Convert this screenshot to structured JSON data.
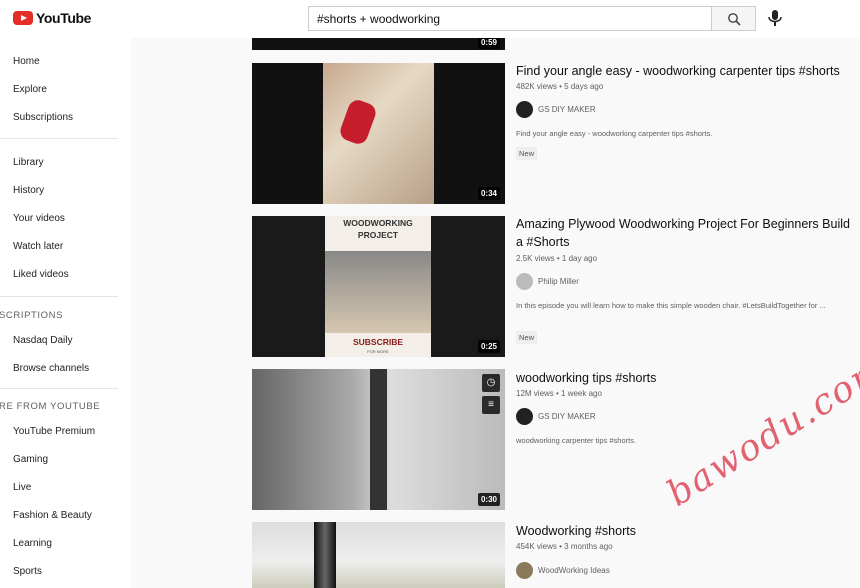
{
  "app": {
    "name": "YouTube"
  },
  "search": {
    "value": "#shorts + woodworking"
  },
  "sidebar": {
    "main": [
      "Home",
      "Explore",
      "Subscriptions"
    ],
    "library": [
      "Library",
      "History",
      "Your videos",
      "Watch later",
      "Liked videos"
    ],
    "subs_title": "SCRIPTIONS",
    "subs": [
      "Nasdaq Daily",
      "Browse channels"
    ],
    "more_title": "RE FROM YOUTUBE",
    "more": [
      "YouTube Premium",
      "Gaming",
      "Live",
      "Fashion & Beauty",
      "Learning",
      "Sports"
    ]
  },
  "videos": [
    {
      "duration": "0:59"
    },
    {
      "title": "Find your angle easy - woodworking carpenter tips #shorts",
      "views": "482K views • 5 days ago",
      "channel": "GS DIY MAKER",
      "desc": "Find your angle easy - woodworking carpenter tips #shorts.",
      "badge": "New",
      "duration": "0:34"
    },
    {
      "title": "Amazing Plywood Woodworking Project For Beginners Build a #Shorts",
      "views": "2.5K views • 1 day ago",
      "channel": "Philip Miller",
      "desc": "In this episode you will learn how to make this simple wooden chair. #LetsBuildTogether for ...",
      "badge": "New",
      "duration": "0:25",
      "overlay_title": "WOODWORKING PROJECT",
      "overlay_cta": "SUBSCRIBE",
      "overlay_small": "FOR MORE"
    },
    {
      "title": "woodworking tips #shorts",
      "views": "12M views • 1 week ago",
      "channel": "GS DIY MAKER",
      "desc": "woodworking carpenter tips #shorts.",
      "duration": "0:30"
    },
    {
      "title": "Woodworking #shorts",
      "views": "454K views • 3 months ago",
      "channel": "WoodWorking Ideas"
    }
  ],
  "watermark": "bawodu.com"
}
